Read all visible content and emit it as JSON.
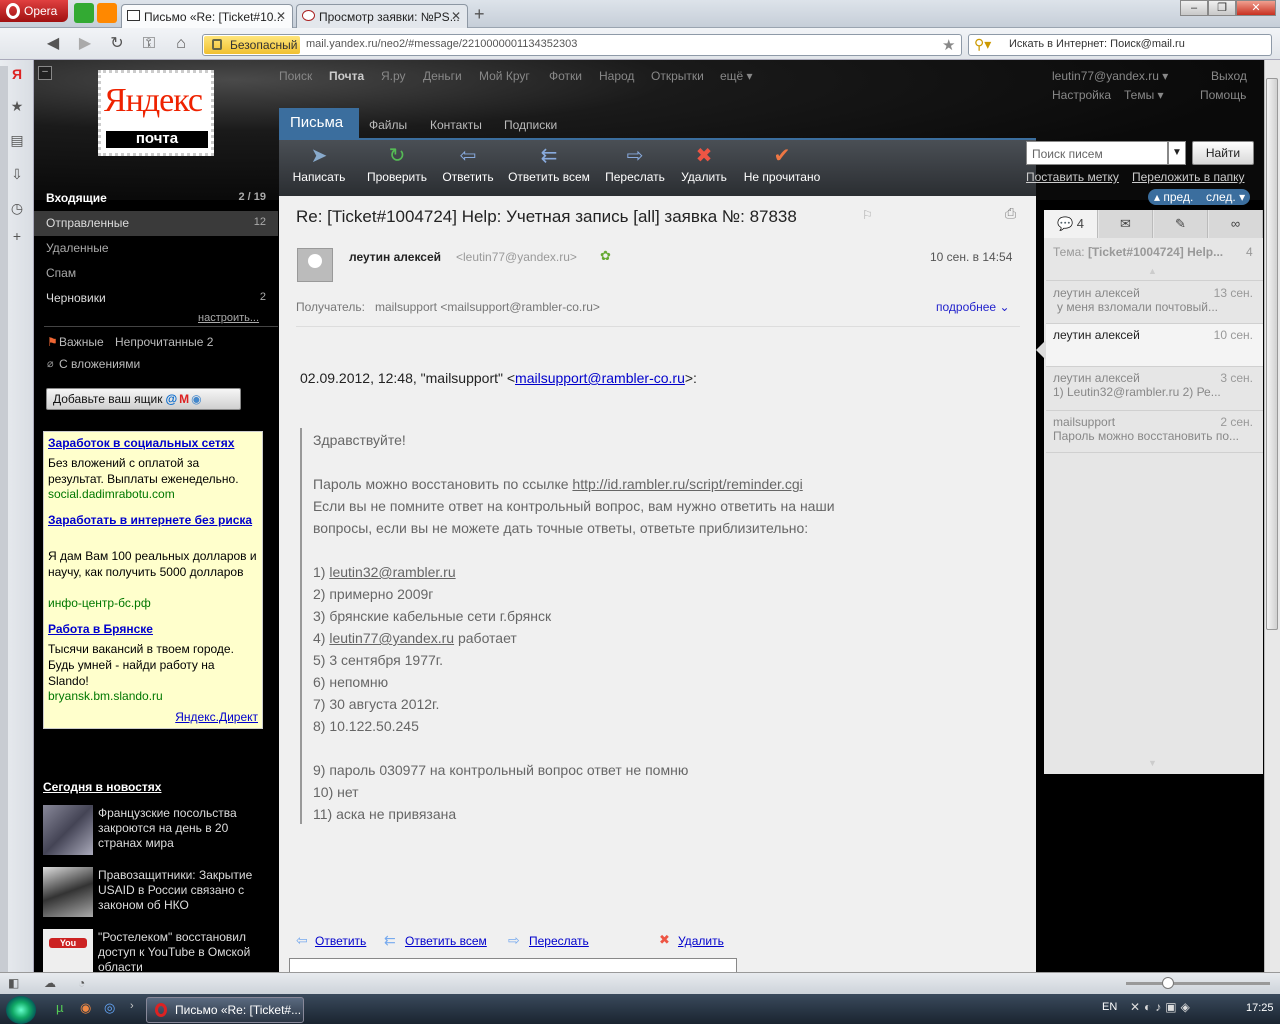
{
  "browser": {
    "menu_label": "Opera",
    "tabs": [
      {
        "label": "Письмо «Re: [Ticket#10..."
      },
      {
        "label": "Просмотр заявки: №PS..."
      }
    ],
    "secure_label": "Безопасный",
    "url": "mail.yandex.ru/neo2/#message/2210000001134352303",
    "search_placeholder": "Искать в Интернет: Поиск@mail.ru"
  },
  "header": {
    "logo_text": "Яндекс",
    "logo_sub": "почта",
    "nav": [
      "Поиск",
      "Почта",
      "Я.ру",
      "Деньги",
      "Мой Круг",
      "Фотки",
      "Народ",
      "Открытки",
      "ещё ▾"
    ],
    "user": "leutin77@yandex.ru ▾",
    "exit": "Выход",
    "settings": "Настройка",
    "themes": "Темы ▾",
    "help": "Помощь",
    "tabs": [
      "Письма",
      "Файлы",
      "Контакты",
      "Подписки"
    ]
  },
  "toolbar": {
    "compose": "Написать",
    "check": "Проверить",
    "reply": "Ответить",
    "reply_all": "Ответить всем",
    "forward": "Переслать",
    "delete": "Удалить",
    "unread": "Не прочитано",
    "search_placeholder": "Поиск писем",
    "search_button": "Найти",
    "set_label": "Поставить метку",
    "move_folder": "Переложить в папку",
    "prev": "▴ пред.",
    "next": "след. ▾"
  },
  "sidebar": {
    "folders": [
      {
        "label": "Входящие",
        "count": "2 / 19"
      },
      {
        "label": "Отправленные",
        "count": "12"
      },
      {
        "label": "Удаленные",
        "count": ""
      },
      {
        "label": "Спам",
        "count": ""
      },
      {
        "label": "Черновики",
        "count": "2"
      }
    ],
    "configure": "настроить...",
    "important": "Важные",
    "unread": "Непрочитанные 2",
    "with_attach": "С вложениями",
    "add_box": "Добавьте ваш ящик"
  },
  "ads": [
    {
      "title": "Заработок в социальных сетях",
      "body": "Без вложений с оплатой за результат. Выплаты еженедельно.",
      "url": "social.dadimrabotu.com"
    },
    {
      "title": "Заработать в интернете без риска",
      "body": "Я дам Вам 100 реальных долларов и научу, как получить 5000 долларов",
      "url": "инфо-центр-бс.рф"
    },
    {
      "title": "Работа в Брянске",
      "body": "Тысячи вакансий в твоем городе. Будь умней - найди работу на Slando!",
      "url": "bryansk.bm.slando.ru"
    }
  ],
  "ads_footer": "Яндекс.Директ",
  "news": {
    "title": "Сегодня в новостях",
    "items": [
      "Французские посольства закроются на день в 20 странах мира",
      "Правозащитники: Закрытие USAID в России связано с законом об НКО",
      "\"Ростелеком\" восстановил доступ к YouTube в Омской области"
    ]
  },
  "message": {
    "subject": "Re: [Ticket#1004724] Help: Учетная запись [all] заявка №: 87838",
    "sender_name": "леутин алексей",
    "sender_email": "<leutin77@yandex.ru>",
    "date": "10 сен. в 14:54",
    "recipient_label": "Получатель:",
    "recipient": "mailsupport <mailsupport@rambler-co.ru>",
    "more": "подробнее",
    "intro_prefix": "02.09.2012, 12:48, \"mailsupport\" <",
    "intro_link": "mailsupport@rambler-co.ru",
    "intro_suffix": ">:",
    "lines": [
      "Здравствуйте!",
      "",
      "Пароль можно восстановить по ссылке ",
      "Если вы не помните ответ на контрольный вопрос, вам нужно ответить на наши",
      "вопросы, если вы не можете дать точные ответы, ответьте приблизительно:",
      "",
      "1) ",
      "2) примерно 2009г",
      "3) брянские кабельные сети г.брянск",
      "4) ",
      "5) 3 сентября 1977г.",
      "6) непомню",
      "7) 30 августа 2012г.",
      "8) 10.122.50.245",
      "",
      "9) пароль 030977 на контрольный вопрос ответ не помню",
      "10) нет",
      "11) аска не привязана"
    ],
    "link_reminder": "http://id.rambler.ru/script/reminder.cgi",
    "link_rambler": "leutin32@rambler.ru",
    "link_yandex": "leutin77@yandex.ru",
    "works": " работает",
    "bottom_reply": "Ответить",
    "bottom_reply_all": "Ответить всем",
    "bottom_forward": "Переслать",
    "bottom_delete": "Удалить"
  },
  "thread": {
    "count": "4",
    "topic_label": "Тема:",
    "topic": "[Ticket#1004724] Help...",
    "topic_count": "4",
    "items": [
      {
        "from": "леутин алексей",
        "date": "13 сен.",
        "snippet": "у меня взломали почтовый..."
      },
      {
        "from": "леутин алексей",
        "date": "10 сен.",
        "snippet": ""
      },
      {
        "from": "леутин алексей",
        "date": "3 сен.",
        "snippet": "1) Leutin32@rambler.ru 2) Ре..."
      },
      {
        "from": "mailsupport",
        "date": "2 сен.",
        "snippet": "Пароль можно восстановить по..."
      }
    ]
  },
  "taskbar": {
    "task": "Письмо «Re: [Ticket#...",
    "lang": "EN",
    "clock": "17:25"
  }
}
